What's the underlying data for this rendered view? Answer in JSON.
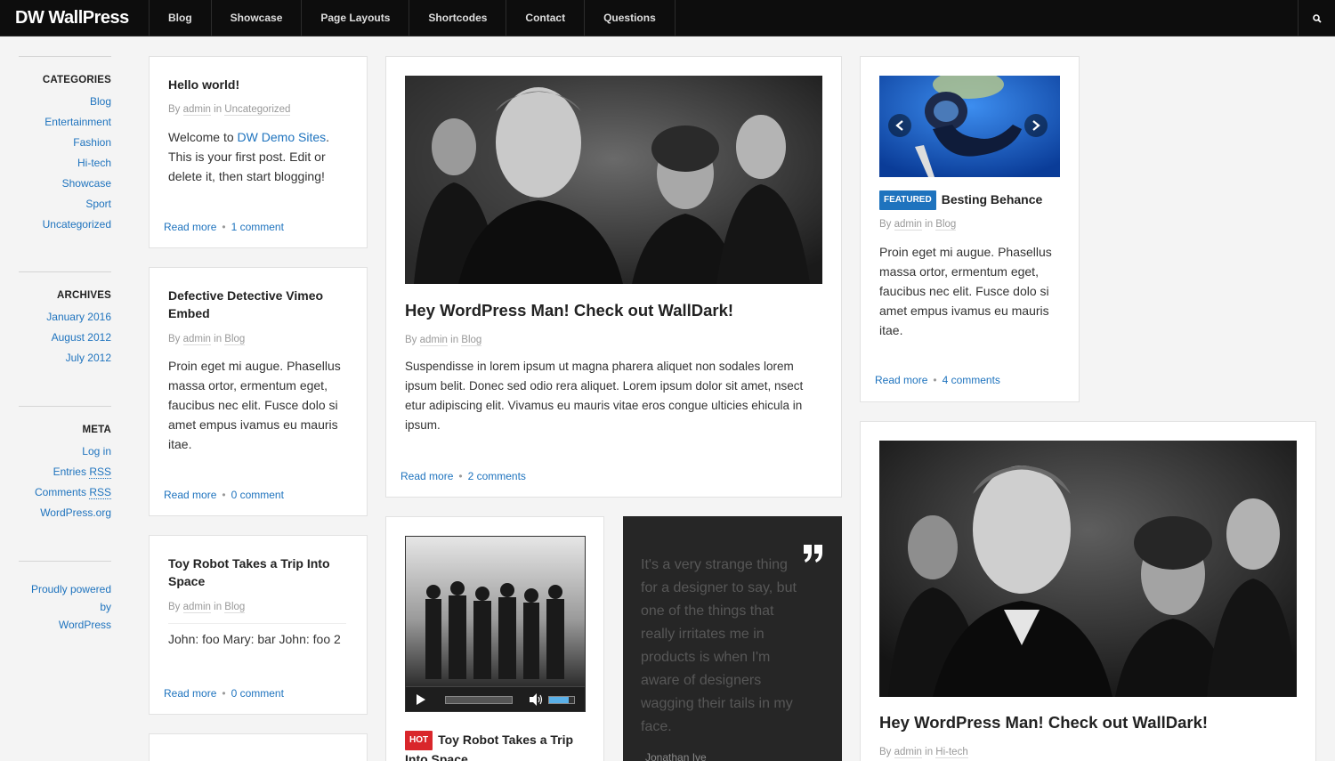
{
  "app": {
    "logo": "DW WallPress",
    "nav": [
      "Blog",
      "Showcase",
      "Page Layouts",
      "Shortcodes",
      "Contact",
      "Questions"
    ]
  },
  "sidebar": {
    "categories": {
      "title": "CATEGORIES",
      "items": [
        "Blog",
        "Entertainment",
        "Fashion",
        "Hi-tech",
        "Showcase",
        "Sport",
        "Uncategorized"
      ]
    },
    "archives": {
      "title": "ARCHIVES",
      "items": [
        "January 2016",
        "August 2012",
        "July 2012"
      ]
    },
    "meta": {
      "title": "META",
      "log_in": "Log in",
      "entries_rss_prefix": "Entries ",
      "comments_rss_prefix": "Comments ",
      "rss": "RSS",
      "wordpress_org": "WordPress.org"
    },
    "footer": {
      "powered_line1": "Proudly powered by",
      "powered_line2": "WordPress"
    }
  },
  "posts": {
    "hello": {
      "title": "Hello world!",
      "by": "By ",
      "author": "admin",
      "in": " in ",
      "category": "Uncategorized",
      "body_prefix": "Welcome to ",
      "body_link": "DW Demo Sites",
      "body_suffix": ". This is your first post. Edit or delete it, then start blogging!",
      "read_more": "Read more",
      "comments": "1 comment"
    },
    "vimeo": {
      "title": "Defective Detective Vimeo Embed",
      "by": "By ",
      "author": "admin",
      "in": " in ",
      "category": "Blog",
      "body": "Proin eget mi augue. Phasellus massa ortor, ermentum eget, faucibus nec elit. Fusce dolo si amet empus ivamus eu mauris itae.",
      "read_more": "Read more",
      "comments": "0 comment"
    },
    "robot_small": {
      "title": "Toy Robot Takes a Trip Into Space",
      "by": "By ",
      "author": "admin",
      "in": " in ",
      "category": "Blog",
      "body": "John: foo Mary: bar John: foo 2",
      "read_more": "Read more",
      "comments": "0 comment"
    },
    "walldark_main": {
      "title": "Hey WordPress Man! Check out WallDark!",
      "by": "By ",
      "author": "admin",
      "in": " in ",
      "category": "Blog",
      "body": "Suspendisse in lorem ipsum ut magna pharera aliquet non sodales lorem ipsum belit. Donec sed odio rera aliquet. Lorem ipsum dolor sit amet, nsect etur adipiscing elit. Vivamus eu mauris vitae eros congue ulticies ehicula in ipsum.",
      "read_more": "Read more",
      "comments": "2 comments"
    },
    "robot_audio": {
      "badge": "HOT",
      "title": "Toy Robot Takes a Trip Into Space..."
    },
    "quote": {
      "text": "It's a very strange thing for a designer to say, but one of the things that really irritates me in products is when I'm aware of designers wagging their tails in my face.",
      "author": "Jonathan Ive"
    },
    "behance": {
      "badge": "FEATURED",
      "title": "Besting Behance",
      "by": "By ",
      "author": "admin",
      "in": " in ",
      "category": "Blog",
      "body": "Proin eget mi augue. Phasellus massa ortor, ermentum eget, faucibus nec elit. Fusce dolo si amet empus ivamus eu mauris itae.",
      "read_more": "Read more",
      "comments": "4 comments"
    },
    "walldark_right": {
      "title": "Hey WordPress Man! Check out WallDark!",
      "by": "By ",
      "author": "admin",
      "in": " in ",
      "category": "Hi-tech"
    }
  },
  "colors": {
    "link": "#1e73be",
    "topbar": "#0d0d0d",
    "featured": "#1e73be",
    "hot": "#d9262b",
    "quote_bg": "#262626"
  },
  "icons": {
    "search": "search-icon",
    "quote": "quote-icon",
    "play": "play-icon",
    "volume": "volume-icon",
    "prev": "chevron-left-icon",
    "next": "chevron-right-icon"
  }
}
